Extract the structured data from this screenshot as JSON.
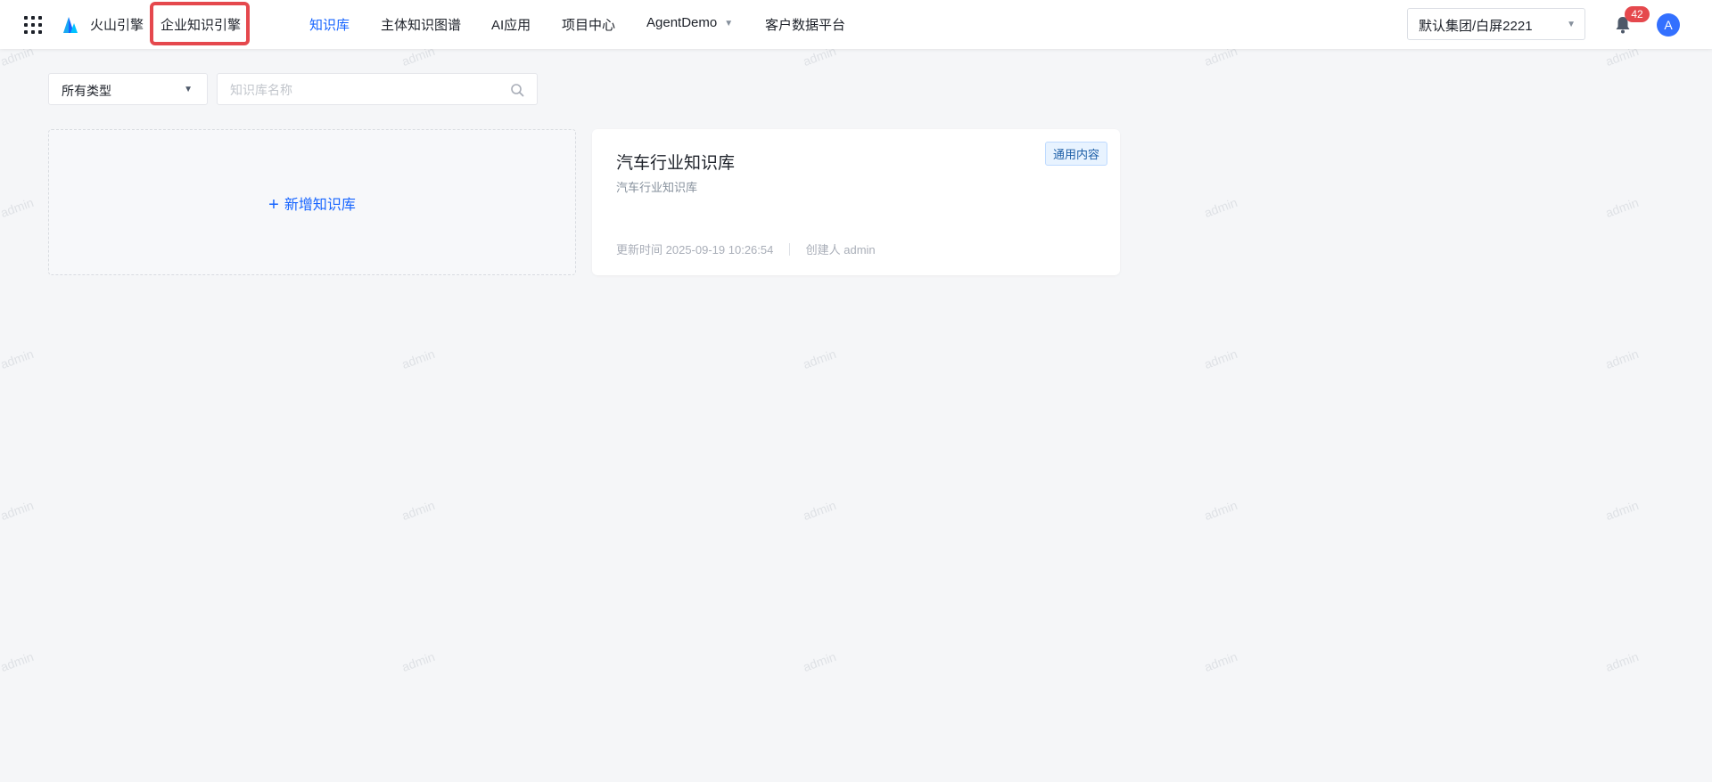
{
  "watermark": "admin",
  "header": {
    "brand": "火山引擎",
    "product": "企业知识引擎",
    "nav": [
      {
        "label": "知识库",
        "active": true
      },
      {
        "label": "主体知识图谱",
        "active": false
      },
      {
        "label": "AI应用",
        "active": false
      },
      {
        "label": "项目中心",
        "active": false
      },
      {
        "label": "AgentDemo",
        "active": false,
        "dropdown": true
      },
      {
        "label": "客户数据平台",
        "active": false
      }
    ],
    "org_select": "默认集团/白屏2221",
    "notification_count": "42",
    "avatar_letter": "A"
  },
  "filters": {
    "type_select": "所有类型",
    "search_placeholder": "知识库名称"
  },
  "add_card": {
    "label": "新增知识库"
  },
  "cards": [
    {
      "title": "汽车行业知识库",
      "description": "汽车行业知识库",
      "tag": "通用内容",
      "updated_label": "更新时间",
      "updated_value": "2025-09-19 10:26:54",
      "creator_label": "创建人",
      "creator_value": "admin"
    }
  ],
  "colors": {
    "accent": "#1664ff",
    "highlight_box": "#e5484d",
    "badge": "#e5484d",
    "avatar": "#3370ff"
  }
}
